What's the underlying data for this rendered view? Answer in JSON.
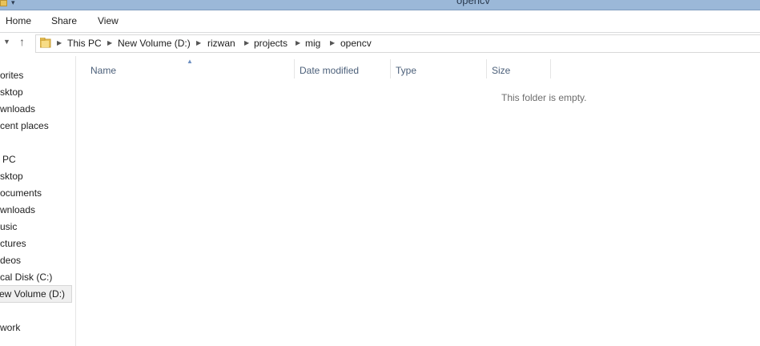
{
  "window": {
    "title": "opencv"
  },
  "ribbon": {
    "tabs": [
      "Home",
      "Share",
      "View"
    ]
  },
  "nav": {
    "up_icon": "up-arrow-icon",
    "dropdown_icon": "chevron-down-icon"
  },
  "breadcrumb": [
    "This PC",
    "New Volume (D:)",
    "rizwan",
    "projects",
    "mig",
    "opencv"
  ],
  "sidebar": {
    "items": [
      "orites",
      "sktop",
      "wnloads",
      "cent places",
      "PC",
      "sktop",
      "ocuments",
      "wnloads",
      "usic",
      "ctures",
      "deos",
      "cal Disk (C:)",
      "ew Volume (D:)",
      "work"
    ]
  },
  "columns": [
    "Name",
    "Date modified",
    "Type",
    "Size"
  ],
  "empty_message": "This folder is empty."
}
